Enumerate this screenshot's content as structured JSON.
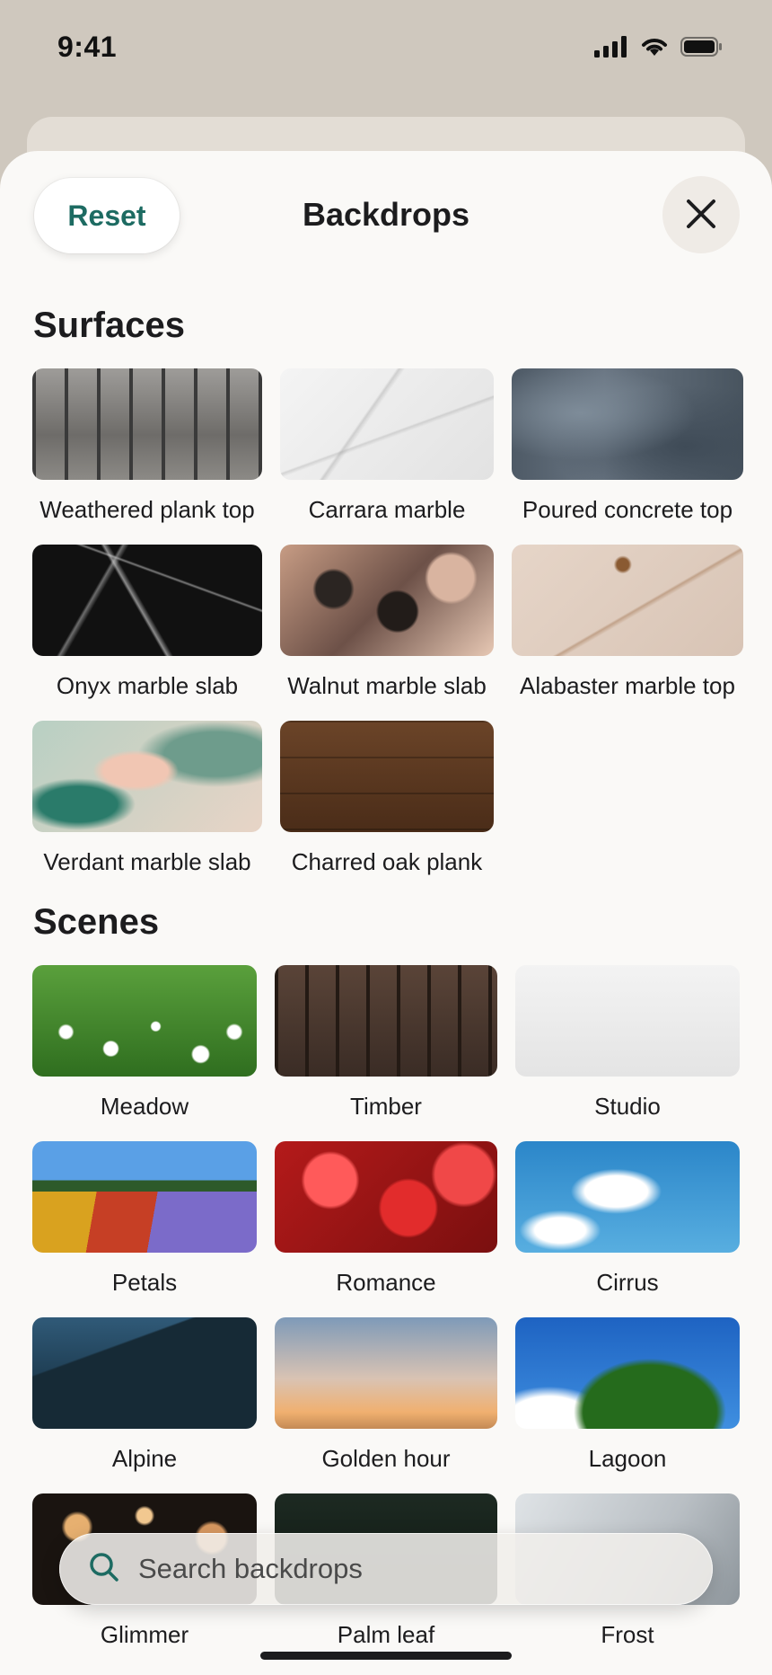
{
  "status_bar": {
    "time": "9:41"
  },
  "header": {
    "reset_label": "Reset",
    "title": "Backdrops"
  },
  "sections": [
    {
      "title": "Surfaces",
      "items": [
        {
          "label": "Weathered plank top"
        },
        {
          "label": "Carrara marble"
        },
        {
          "label": "Poured concrete top"
        },
        {
          "label": "Onyx marble slab"
        },
        {
          "label": "Walnut marble slab"
        },
        {
          "label": "Alabaster marble top"
        },
        {
          "label": "Verdant marble slab"
        },
        {
          "label": "Charred oak plank"
        }
      ]
    },
    {
      "title": "Scenes",
      "items": [
        {
          "label": "Meadow"
        },
        {
          "label": "Timber"
        },
        {
          "label": "Studio"
        },
        {
          "label": "Petals"
        },
        {
          "label": "Romance"
        },
        {
          "label": "Cirrus"
        },
        {
          "label": "Alpine"
        },
        {
          "label": "Golden hour"
        },
        {
          "label": "Lagoon"
        },
        {
          "label": "Glimmer"
        },
        {
          "label": "Palm leaf"
        },
        {
          "label": "Frost"
        }
      ]
    }
  ],
  "search": {
    "placeholder": "Search backdrops"
  },
  "colors": {
    "accent": "#1d6b62",
    "sheet_bg": "#faf9f7",
    "backdrop_bg": "#cfc8be"
  }
}
